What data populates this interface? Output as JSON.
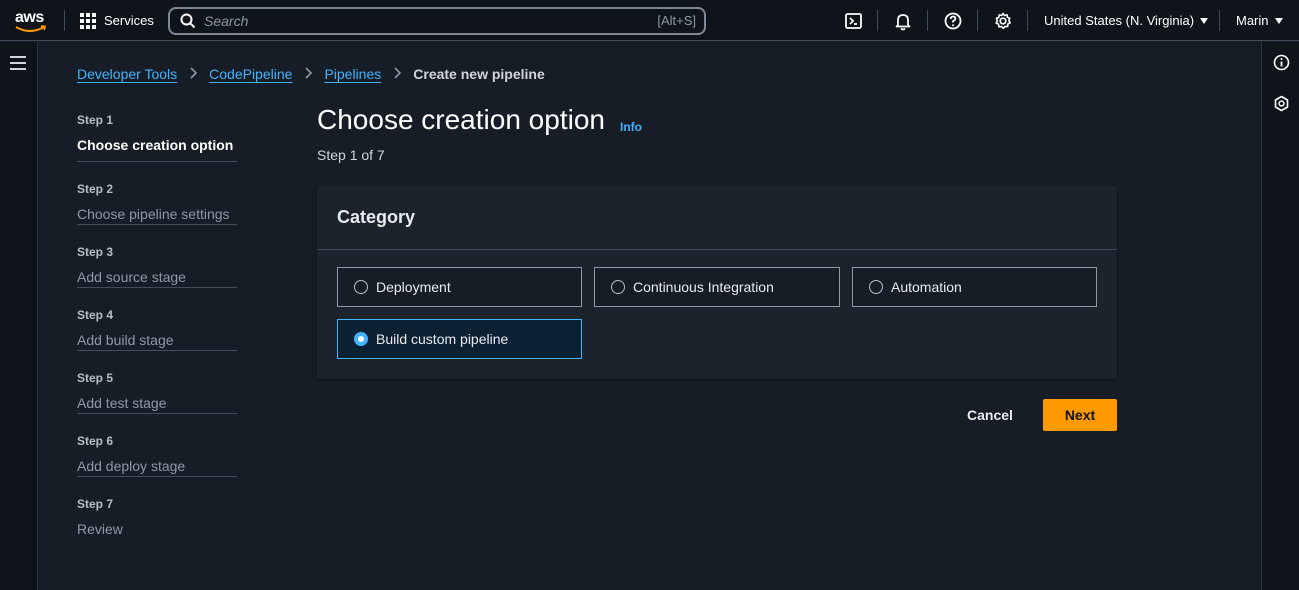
{
  "topnav": {
    "logo_text": "aws",
    "services_label": "Services",
    "search_placeholder": "Search",
    "search_shortcut": "[Alt+S]",
    "region_label": "United States (N. Virginia)",
    "user_label": "Marin"
  },
  "breadcrumb": {
    "items": [
      "Developer Tools",
      "CodePipeline",
      "Pipelines"
    ],
    "current": "Create new pipeline"
  },
  "steps": [
    {
      "num": "Step 1",
      "title": "Choose creation option"
    },
    {
      "num": "Step 2",
      "title": "Choose pipeline settings"
    },
    {
      "num": "Step 3",
      "title": "Add source stage"
    },
    {
      "num": "Step 4",
      "title": "Add build stage"
    },
    {
      "num": "Step 5",
      "title": "Add test stage"
    },
    {
      "num": "Step 6",
      "title": "Add deploy stage"
    },
    {
      "num": "Step 7",
      "title": "Review"
    }
  ],
  "main": {
    "title": "Choose creation option",
    "info": "Info",
    "step_of": "Step 1 of 7"
  },
  "category": {
    "heading": "Category",
    "options": [
      "Deployment",
      "Continuous Integration",
      "Automation",
      "Build custom pipeline"
    ],
    "selected": "Build custom pipeline"
  },
  "actions": {
    "cancel": "Cancel",
    "next": "Next"
  },
  "colors": {
    "accent": "#42b4ff",
    "primary_button": "#ff9900",
    "background": "#161d26"
  }
}
